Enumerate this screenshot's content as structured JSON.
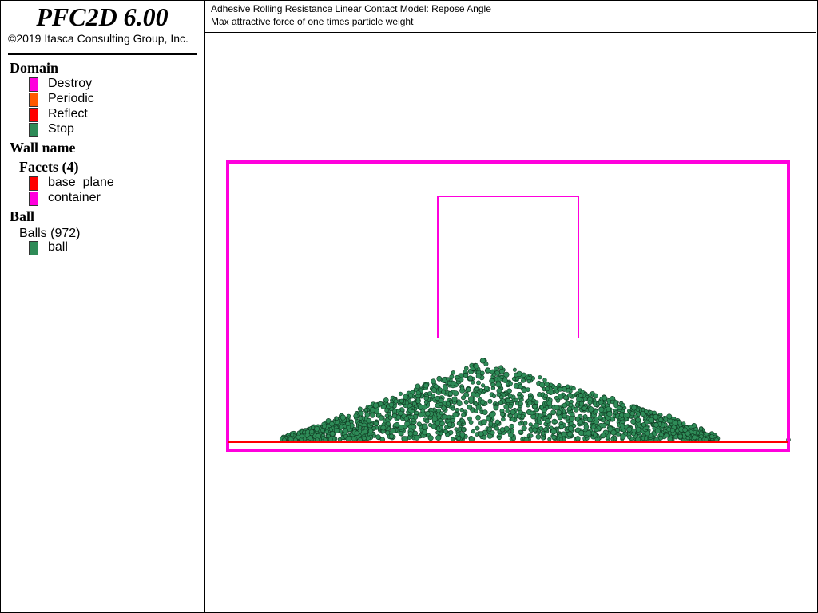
{
  "app": {
    "title": "PFC2D 6.00",
    "copyright": "©2019 Itasca Consulting Group, Inc."
  },
  "caption": {
    "line1": "Adhesive Rolling Resistance Linear Contact Model: Repose Angle",
    "line2": "Max attractive force of one times particle weight"
  },
  "legend": {
    "domain": {
      "title": "Domain",
      "items": [
        {
          "label": "Destroy",
          "color": "#ff00dd"
        },
        {
          "label": "Periodic",
          "color": "#ff5a00"
        },
        {
          "label": "Reflect",
          "color": "#ff0000"
        },
        {
          "label": "Stop",
          "color": "#2e8b57"
        }
      ]
    },
    "wall": {
      "title": "Wall name",
      "facets_title": "Facets (4)",
      "items": [
        {
          "label": "base_plane",
          "color": "#ff0000"
        },
        {
          "label": "container",
          "color": "#ff00dd"
        }
      ]
    },
    "ball": {
      "title": "Ball",
      "balls_title": "Balls (972)",
      "items": [
        {
          "label": "ball",
          "color": "#2e8b57"
        }
      ]
    }
  },
  "colors": {
    "container": "#ff00dd",
    "base_plane": "#ff0000",
    "ball": "#2e8b57"
  }
}
